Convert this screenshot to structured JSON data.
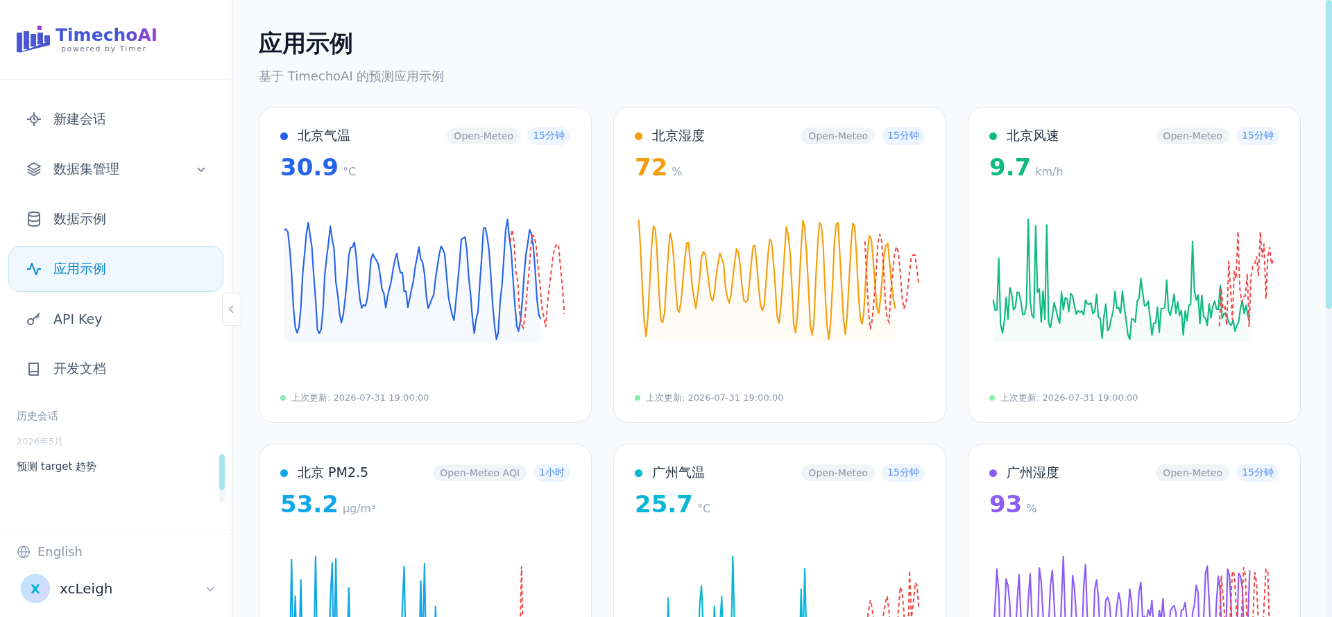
{
  "sidebar": {
    "logo": {
      "name": "TimechoAI",
      "tagline": "powered by Timer"
    },
    "nav": [
      {
        "label": "新建会话",
        "selected": false
      },
      {
        "label": "数据集管理",
        "selected": false,
        "expanded": false
      },
      {
        "label": "数据示例",
        "selected": false
      },
      {
        "label": "应用示例",
        "selected": true
      },
      {
        "label": "API Key",
        "selected": false
      },
      {
        "label": "开发文档",
        "selected": false
      }
    ],
    "history": {
      "heading": "历史会话",
      "groups": [
        {
          "label": "2026年5月",
          "items": [
            "预测 target 趋势"
          ]
        }
      ]
    },
    "language": "English",
    "user": {
      "initial": "X",
      "name": "xcLeigh"
    }
  },
  "page": {
    "title": "应用示例",
    "subtitle": "基于 TimechoAI 的预测应用示例"
  },
  "cards": [
    {
      "title": "北京气温",
      "color": "#2563eb",
      "source": "Open-Meteo",
      "interval": "15分钟",
      "value": "30.9",
      "unit": "°C",
      "updated": "上次更新: 2026-07-31 19:00:00"
    },
    {
      "title": "北京湿度",
      "color": "#f59e0b",
      "source": "Open-Meteo",
      "interval": "15分钟",
      "value": "72",
      "unit": "%",
      "updated": "上次更新: 2026-07-31 19:00:00"
    },
    {
      "title": "北京风速",
      "color": "#10b981",
      "source": "Open-Meteo",
      "interval": "15分钟",
      "value": "9.7",
      "unit": "km/h",
      "updated": "上次更新: 2026-07-31 19:00:00"
    },
    {
      "title": "北京 PM2.5",
      "color": "#0ea5e9",
      "source": "Open-Meteo AQI",
      "interval": "1小时",
      "value": "53.2",
      "unit": "μg/m³"
    },
    {
      "title": "广州气温",
      "color": "#06b6d4",
      "source": "Open-Meteo",
      "interval": "15分钟",
      "value": "25.7",
      "unit": "°C"
    },
    {
      "title": "广州湿度",
      "color": "#8b5cf6",
      "source": "Open-Meteo",
      "interval": "15分钟",
      "value": "93",
      "unit": "%"
    }
  ]
}
